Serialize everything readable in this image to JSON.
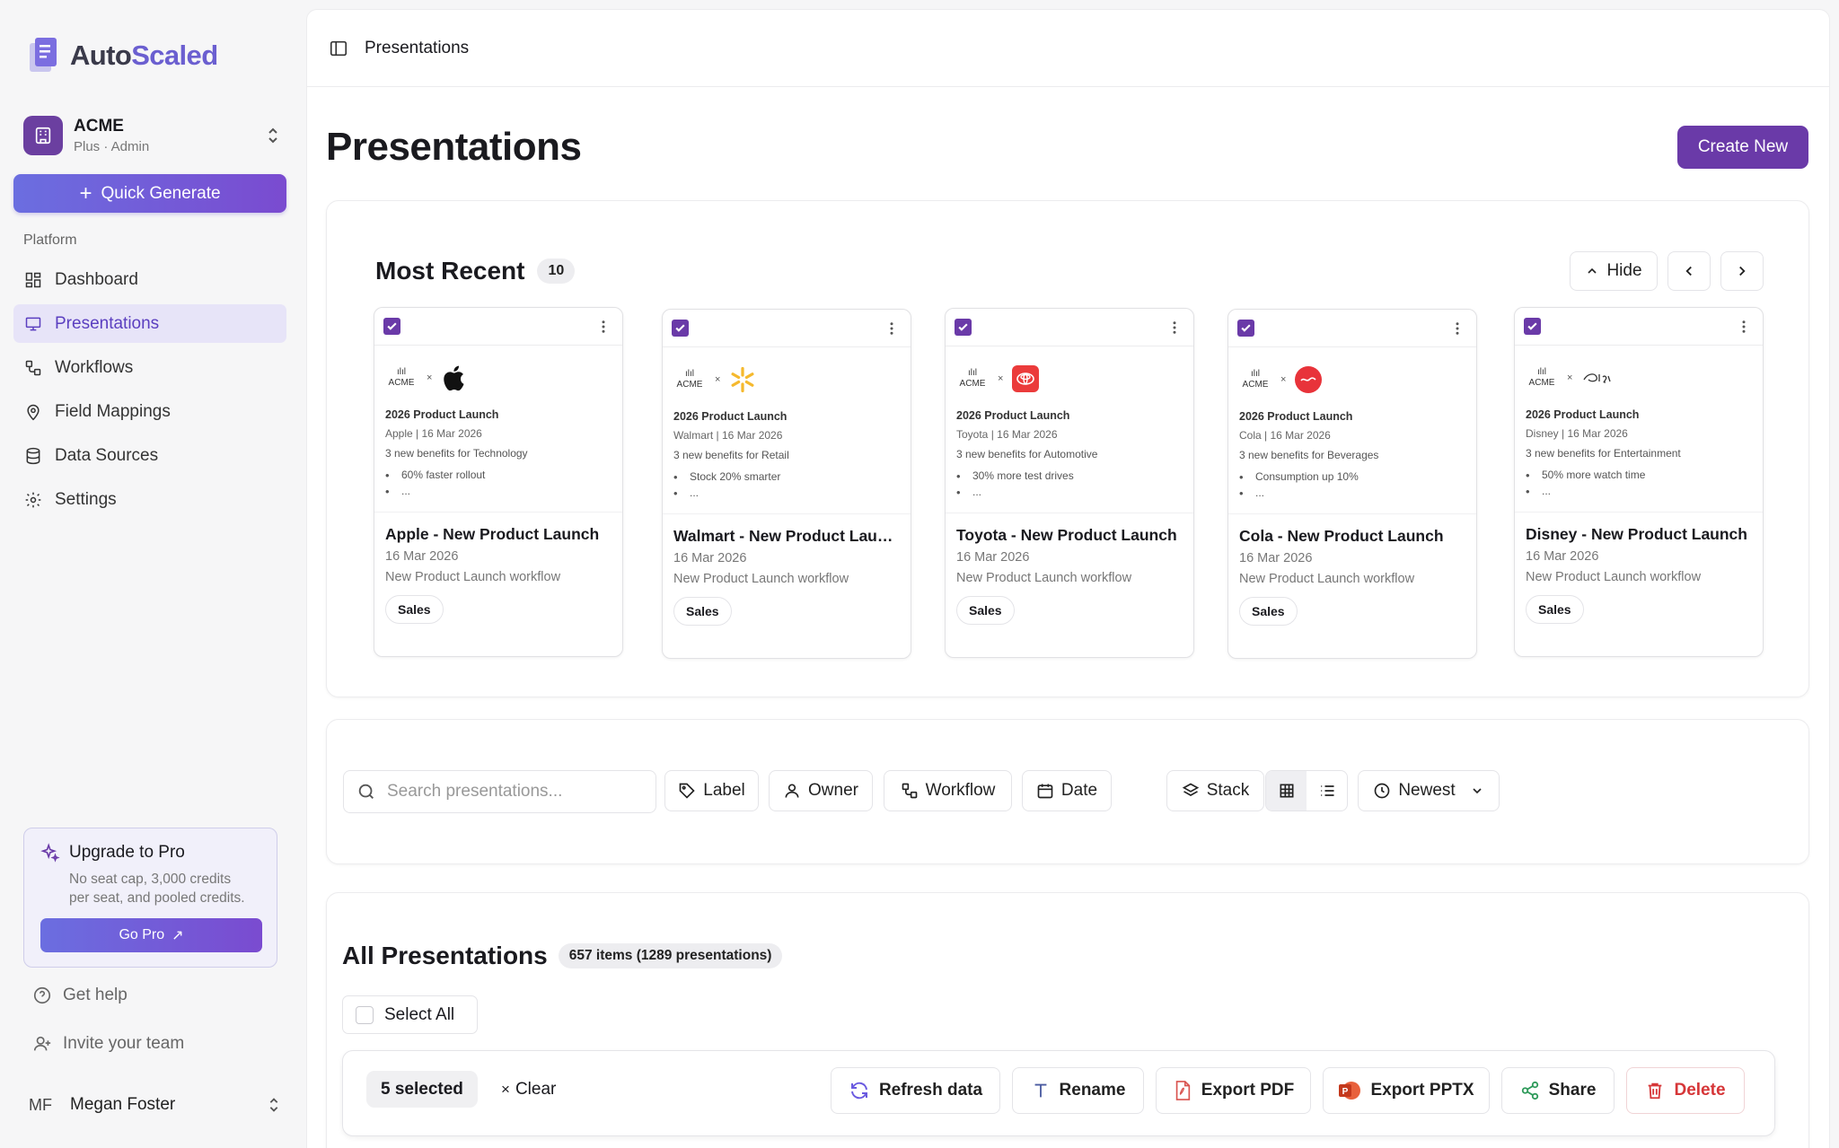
{
  "brand": {
    "name_a": "Auto",
    "name_b": "Scaled"
  },
  "org": {
    "name": "ACME",
    "plan": "Plus · Admin"
  },
  "quick_generate": "Quick Generate",
  "sidebar": {
    "section": "Platform",
    "items": [
      {
        "label": "Dashboard",
        "icon": "dashboard-icon"
      },
      {
        "label": "Presentations",
        "icon": "presentation-icon",
        "active": true
      },
      {
        "label": "Workflows",
        "icon": "workflow-icon"
      },
      {
        "label": "Field Mappings",
        "icon": "location-pin-icon"
      },
      {
        "label": "Data Sources",
        "icon": "database-icon"
      },
      {
        "label": "Settings",
        "icon": "gear-icon"
      }
    ],
    "upgrade": {
      "title": "Upgrade to Pro",
      "desc_1": "No seat cap, 3,000 credits",
      "desc_2": "per seat, and pooled credits.",
      "cta": "Go Pro"
    },
    "help": "Get help",
    "invite": "Invite your team",
    "user": {
      "initials": "MF",
      "name": "Megan Foster"
    }
  },
  "topbar": {
    "title": "Presentations"
  },
  "page": {
    "title": "Presentations",
    "create": "Create New"
  },
  "recent": {
    "title": "Most Recent",
    "count": "10",
    "hide": "Hide",
    "cards": [
      {
        "brand": "Apple",
        "brand_color": "#111111",
        "slide_title": "2026 Product Launch",
        "slide_sub": "Apple | 16 Mar 2026",
        "slide_line": "3 new benefits for Technology",
        "bullet": "60% faster rollout",
        "bullet2": "...",
        "title": "Apple - New Product Launch",
        "date": "16 Mar 2026",
        "workflow": "New Product Launch workflow",
        "tag": "Sales"
      },
      {
        "brand": "Walmart",
        "brand_color": "#f5b92e",
        "slide_title": "2026 Product Launch",
        "slide_sub": "Walmart | 16 Mar 2026",
        "slide_line": "3 new benefits for Retail",
        "bullet": "Stock 20% smarter",
        "bullet2": "...",
        "title": "Walmart - New Product Launch",
        "date": "16 Mar 2026",
        "workflow": "New Product Launch workflow",
        "tag": "Sales"
      },
      {
        "brand": "Toyota",
        "brand_color": "#eb3b3b",
        "slide_title": "2026 Product Launch",
        "slide_sub": "Toyota | 16 Mar 2026",
        "slide_line": "3 new benefits for Automotive",
        "bullet": "30% more test drives",
        "bullet2": "...",
        "title": "Toyota - New Product Launch",
        "date": "16 Mar 2026",
        "workflow": "New Product Launch workflow",
        "tag": "Sales"
      },
      {
        "brand": "Cola",
        "brand_color": "#e8333a",
        "slide_title": "2026 Product Launch",
        "slide_sub": "Cola | 16 Mar 2026",
        "slide_line": "3 new benefits for Beverages",
        "bullet": "Consumption up 10%",
        "bullet2": "...",
        "title": "Cola - New Product Launch",
        "date": "16 Mar 2026",
        "workflow": "New Product Launch workflow",
        "tag": "Sales"
      },
      {
        "brand": "Disney",
        "brand_color": "#333333",
        "slide_title": "2026 Product Launch",
        "slide_sub": "Disney | 16 Mar 2026",
        "slide_line": "3 new benefits for Entertainment",
        "bullet": "50% more watch time",
        "bullet2": "...",
        "title": "Disney - New Product Launch",
        "date": "16 Mar 2026",
        "workflow": "New Product Launch workflow",
        "tag": "Sales"
      }
    ],
    "acme_mini": "ACME",
    "times": "×"
  },
  "filters": {
    "search_placeholder": "Search presentations...",
    "label": "Label",
    "owner": "Owner",
    "workflow": "Workflow",
    "date": "Date",
    "stack": "Stack",
    "sort": "Newest"
  },
  "all": {
    "title": "All Presentations",
    "count": "657 items (1289 presentations)",
    "select_all": "Select All",
    "selected": "5 selected",
    "clear": "Clear",
    "actions": {
      "refresh": "Refresh data",
      "rename": "Rename",
      "export_pdf": "Export PDF",
      "export_pptx": "Export PPTX",
      "share": "Share",
      "delete": "Delete"
    }
  },
  "colors": {
    "accent": "#6a3aa8",
    "danger": "#d63638"
  }
}
